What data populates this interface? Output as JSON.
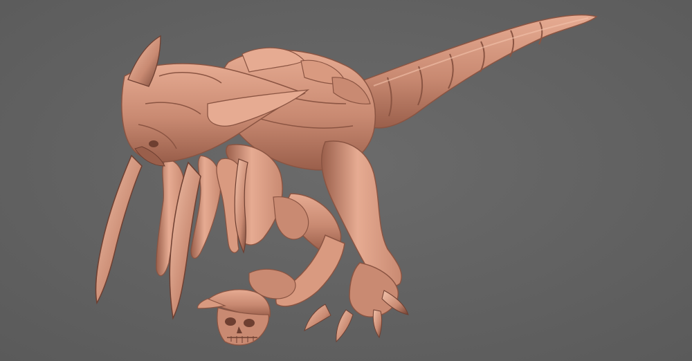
{
  "scene": {
    "background_color": "#6b6b6b",
    "background_vignette": "#5a5a5a",
    "material": {
      "base": "#c98a72",
      "light": "#e6ab92",
      "highlight": "#f3c3ab",
      "shadow": "#9a5f4b",
      "deep": "#6e3f31"
    },
    "subjects": [
      "creature-sculpt",
      "skull-with-cap"
    ]
  }
}
